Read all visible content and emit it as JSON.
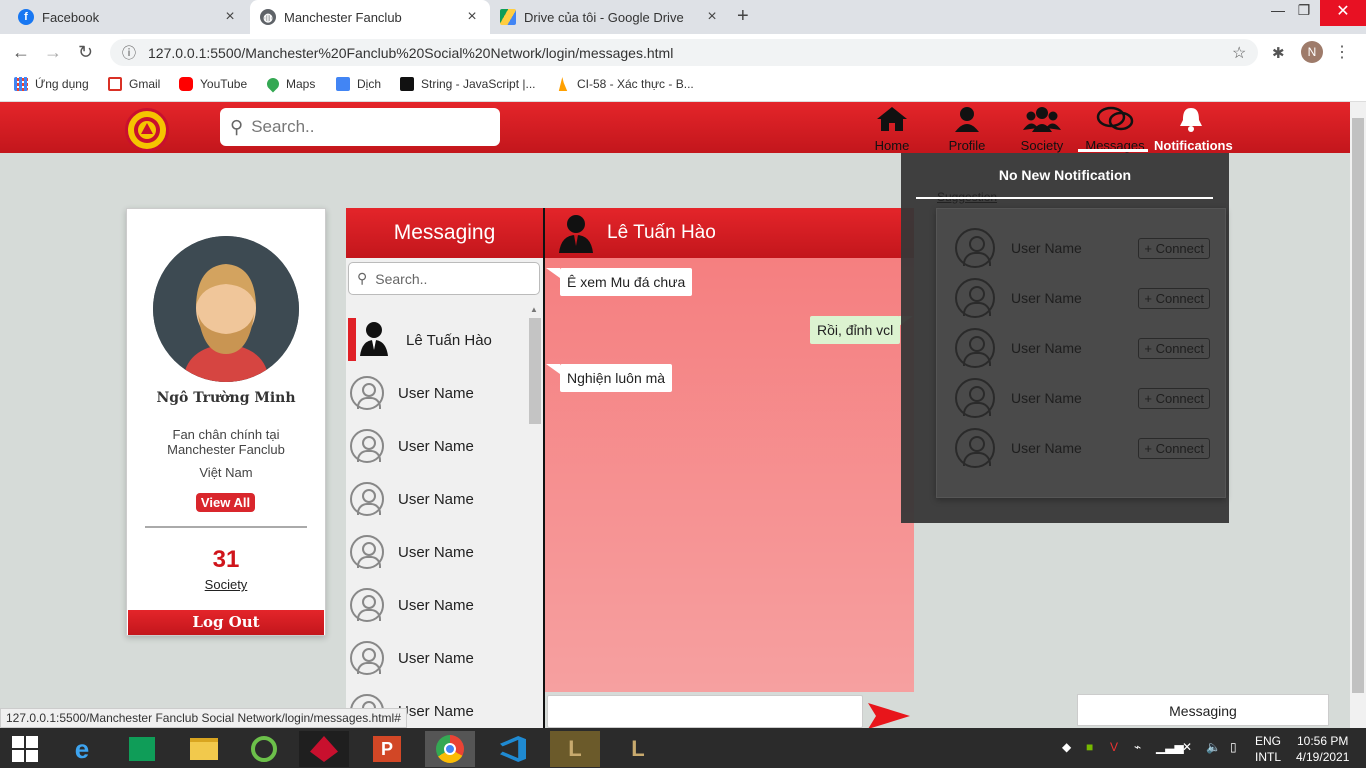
{
  "browser": {
    "tabs": [
      {
        "label": "Facebook",
        "icon": "facebook-icon"
      },
      {
        "label": "Manchester Fanclub",
        "icon": "globe-icon"
      },
      {
        "label": "Drive của tôi - Google Drive",
        "icon": "google-drive-icon"
      }
    ],
    "new_tab": "+",
    "address": "127.0.0.1:5500/Manchester%20Fanclub%20Social%20Network/login/messages.html",
    "profile_initial": "N",
    "bookmarks": [
      {
        "label": "Ứng dụng",
        "icon": "apps-grid-icon",
        "color": "#4285f4"
      },
      {
        "label": "Gmail",
        "icon": "gmail-icon",
        "color": "#d93025"
      },
      {
        "label": "YouTube",
        "icon": "youtube-icon",
        "color": "#ff0000"
      },
      {
        "label": "Maps",
        "icon": "maps-pin-icon",
        "color": "#34a853"
      },
      {
        "label": "Dịch",
        "icon": "translate-icon",
        "color": "#4285f4"
      },
      {
        "label": "String - JavaScript |...",
        "icon": "mdn-icon",
        "color": "#111111"
      },
      {
        "label": "CI-58 - Xác thực - B...",
        "icon": "firebase-icon",
        "color": "#ffa000"
      }
    ]
  },
  "header": {
    "search_placeholder": "Search..",
    "nav": [
      {
        "label": "Home",
        "icon": "home-icon"
      },
      {
        "label": "Profile",
        "icon": "user-icon"
      },
      {
        "label": "Society",
        "icon": "group-icon"
      },
      {
        "label": "Messages",
        "icon": "chat-bubbles-icon"
      },
      {
        "label": "Notifications",
        "icon": "bell-icon"
      }
    ]
  },
  "profile": {
    "name": "Ngô Trường Minh",
    "desc_line1": "Fan chân chính tại",
    "desc_line2": "Manchester Fanclub",
    "country": "Việt Nam",
    "view_all": "View All",
    "society_count": "31",
    "society_label": "Society",
    "logout": "Log Out"
  },
  "messaging": {
    "title": "Messaging",
    "search_placeholder": "Search..",
    "contacts": [
      {
        "name": "Lê Tuấn Hào",
        "active": true
      },
      {
        "name": "User Name"
      },
      {
        "name": "User Name"
      },
      {
        "name": "User Name"
      },
      {
        "name": "User Name"
      },
      {
        "name": "User Name"
      },
      {
        "name": "User Name"
      },
      {
        "name": "User Name"
      }
    ]
  },
  "chat": {
    "contact_name": "Lê Tuấn Hào",
    "messages": [
      {
        "text": "Ê xem Mu đá chưa",
        "from": "them"
      },
      {
        "text": "Rồi, đỉnh vcl",
        "from": "me"
      },
      {
        "text": "Nghiện luôn mà",
        "from": "them"
      }
    ]
  },
  "notifications": {
    "title": "No New Notification",
    "suggestion_label": "Suggestion",
    "suggestions": [
      {
        "name": "User Name",
        "action": "+ Connect"
      },
      {
        "name": "User Name",
        "action": "+ Connect"
      },
      {
        "name": "User Name",
        "action": "+ Connect"
      },
      {
        "name": "User Name",
        "action": "+ Connect"
      },
      {
        "name": "User Name",
        "action": "+ Connect"
      }
    ]
  },
  "floating_messaging": "Messaging",
  "status_url": "127.0.0.1:5500/Manchester Fanclub Social Network/login/messages.html#",
  "taskbar": {
    "lang_top": "ENG",
    "lang_bottom": "INTL",
    "time": "10:56 PM",
    "date": "4/19/2021"
  },
  "colors": {
    "brand_red": "#e02026",
    "chat_bg": "#f57f80",
    "sent_bubble": "#dcf3d0"
  }
}
